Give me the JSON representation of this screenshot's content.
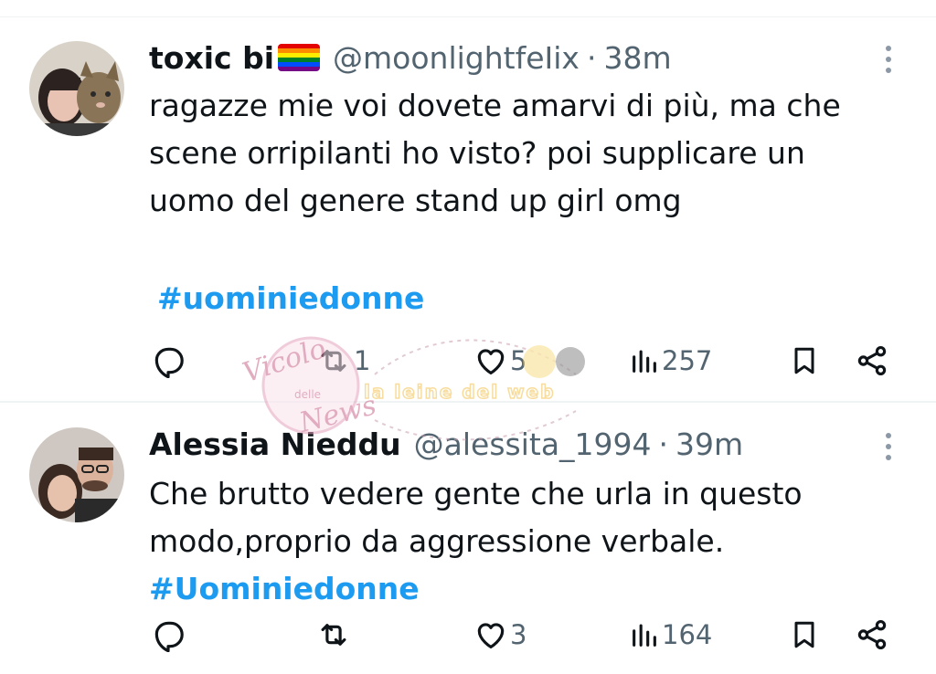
{
  "tweets": [
    {
      "name": "toxic bi",
      "flag_icon": "rainbow-flag-icon",
      "handle": "@moonlightfeIix",
      "separator": "·",
      "time": "38m",
      "text_lines": [
        "ragazze mie voi dovete amarvi di più, ma che",
        "scene orripilanti ho visto? poi supplicare un",
        "uomo del genere stand up girl omg"
      ],
      "hashtag": "#uominiedonne",
      "replies": "",
      "retweets": "1",
      "likes": "5",
      "views": "257"
    },
    {
      "name": "Alessia Nieddu",
      "handle": "@alessita_1994",
      "separator": "·",
      "time": "39m",
      "text_lines": [
        "Che brutto vedere gente che urla in questo",
        "modo,proprio da aggressione verbale."
      ],
      "hashtag": "#Uominiedonne",
      "replies": "",
      "retweets": "",
      "likes": "3",
      "views": "164"
    }
  ],
  "watermark": {
    "script_line1": "Vicolo",
    "script_small": "delle",
    "script_line2": "News",
    "tagline": "la leine del web"
  },
  "colors": {
    "link": "#1d9bf0",
    "muted": "#536471",
    "text": "#0f1419",
    "watermark_pink": "#d98aa8"
  }
}
